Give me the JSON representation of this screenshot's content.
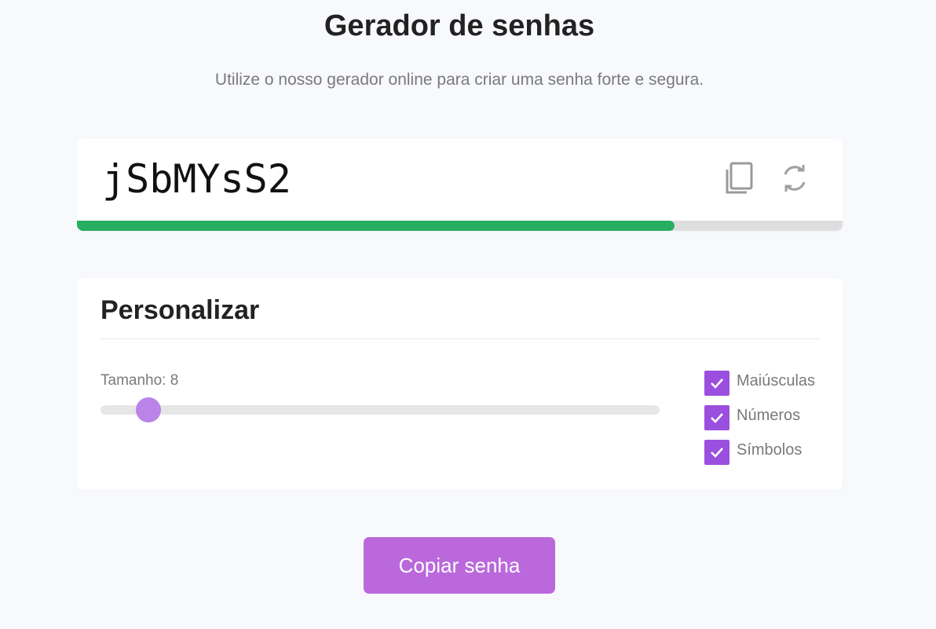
{
  "header": {
    "title": "Gerador de senhas",
    "subtitle": "Utilize o nosso gerador online para criar uma senha forte e segura."
  },
  "password": {
    "value": "jSbMYsS2",
    "copy_icon": "copy-icon",
    "refresh_icon": "refresh-icon",
    "strength_fraction": 0.78,
    "strength_color": "#27ae60"
  },
  "customize": {
    "title": "Personalizar",
    "length_label": "Tamanho: 8",
    "length_value": 8,
    "slider_fraction": 0.085,
    "options": [
      {
        "label": "Maiúsculas",
        "checked": true
      },
      {
        "label": "Números",
        "checked": true
      },
      {
        "label": "Símbolos",
        "checked": true
      }
    ],
    "checkbox_color": "#9b4fde"
  },
  "actions": {
    "copy_button_label": "Copiar senha",
    "button_color": "#ba68dc"
  }
}
